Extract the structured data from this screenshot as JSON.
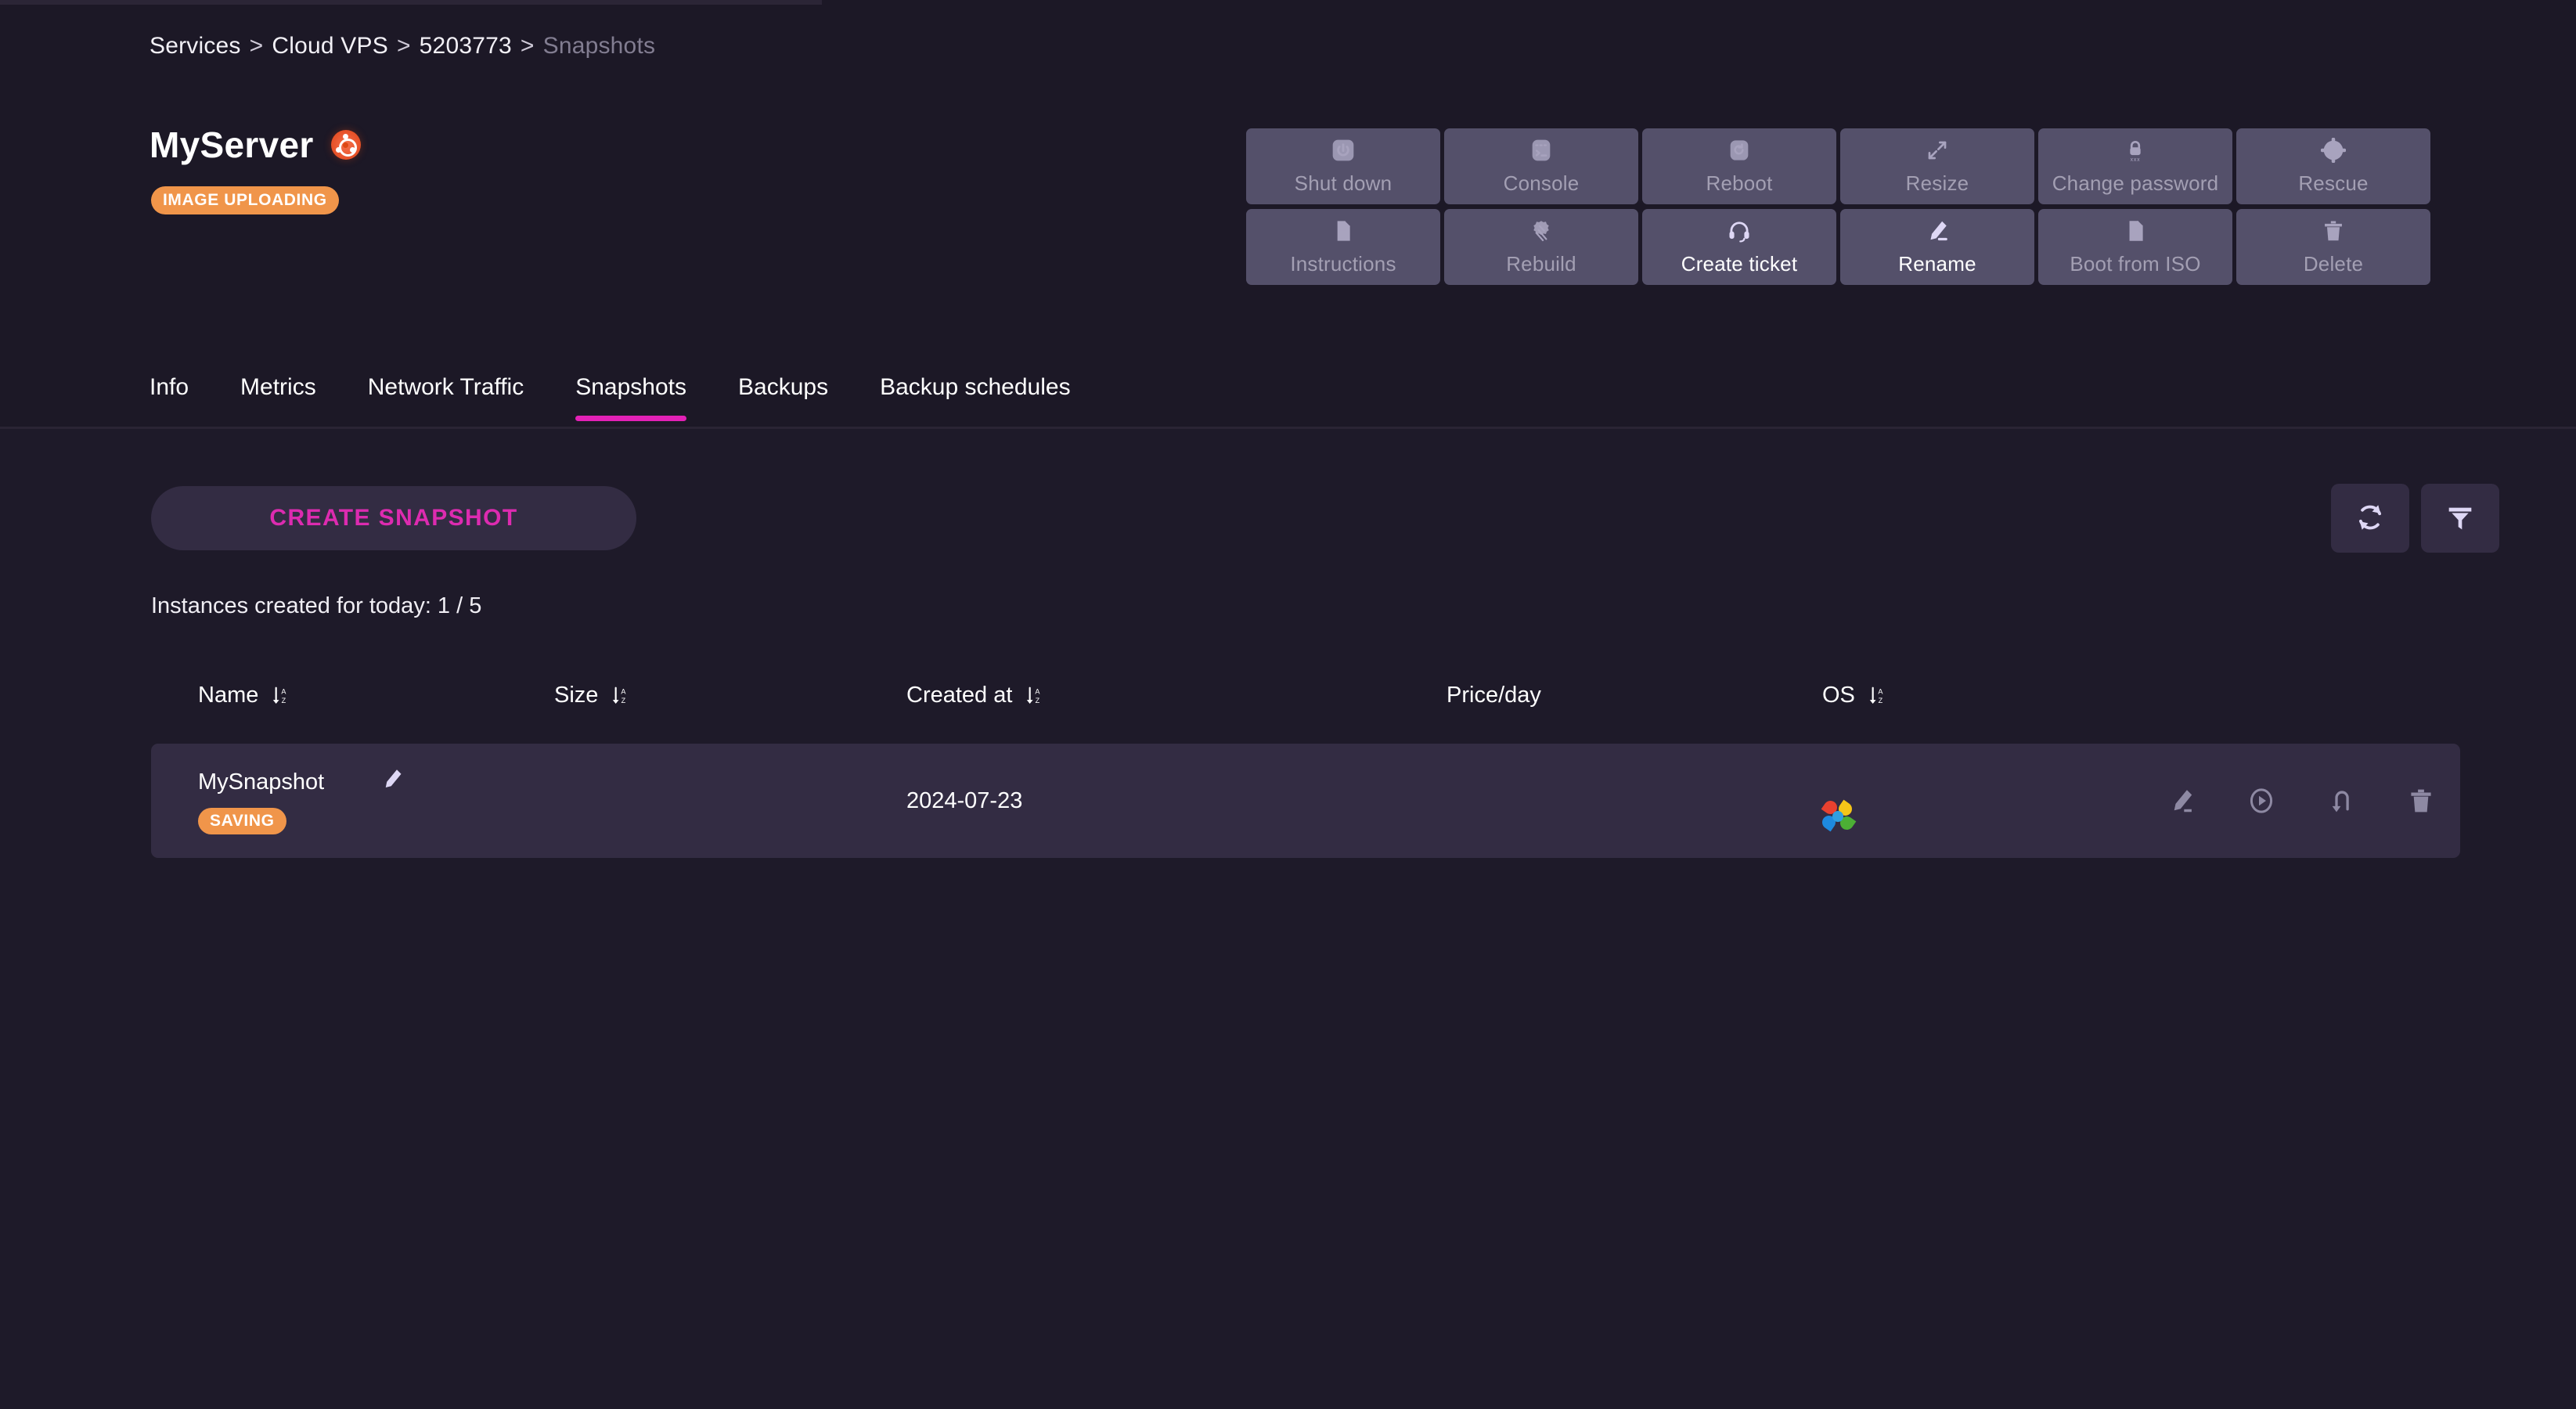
{
  "breadcrumb": {
    "items": [
      {
        "label": "Services",
        "muted": false
      },
      {
        "label": "Cloud VPS",
        "muted": false
      },
      {
        "label": "5203773",
        "muted": false
      },
      {
        "label": "Snapshots",
        "muted": true
      }
    ],
    "separator": ">"
  },
  "header": {
    "title": "MyServer",
    "os_icon": "ubuntu-logo-icon",
    "status_badge": "IMAGE UPLOADING",
    "status_color": "#f0954a"
  },
  "actions": [
    {
      "label": "Shut down",
      "icon": "power-icon",
      "enabled": false
    },
    {
      "label": "Console",
      "icon": "terminal-icon",
      "enabled": false
    },
    {
      "label": "Reboot",
      "icon": "restart-icon",
      "enabled": false
    },
    {
      "label": "Resize",
      "icon": "expand-icon",
      "enabled": false
    },
    {
      "label": "Change password",
      "icon": "lock-icon",
      "enabled": false
    },
    {
      "label": "Rescue",
      "icon": "lifebuoy-icon",
      "enabled": false
    },
    {
      "label": "Instructions",
      "icon": "document-icon",
      "enabled": false
    },
    {
      "label": "Rebuild",
      "icon": "rebuild-icon",
      "enabled": false
    },
    {
      "label": "Create ticket",
      "icon": "headset-icon",
      "enabled": true
    },
    {
      "label": "Rename",
      "icon": "pencil-icon",
      "enabled": true
    },
    {
      "label": "Boot from ISO",
      "icon": "iso-file-icon",
      "enabled": false
    },
    {
      "label": "Delete",
      "icon": "trash-icon",
      "enabled": false
    }
  ],
  "tabs": [
    {
      "label": "Info",
      "active": false
    },
    {
      "label": "Metrics",
      "active": false
    },
    {
      "label": "Network Traffic",
      "active": false
    },
    {
      "label": "Snapshots",
      "active": true
    },
    {
      "label": "Backups",
      "active": false
    },
    {
      "label": "Backup schedules",
      "active": false
    }
  ],
  "tab_accent_color": "#e321b6",
  "toolbar": {
    "create_snapshot_label": "CREATE SNAPSHOT",
    "instances_line": "Instances created for today: 1 / 5",
    "refresh_icon": "refresh-icon",
    "filter_icon": "filter-icon"
  },
  "table": {
    "columns": [
      {
        "label": "Name",
        "sortable": true
      },
      {
        "label": "Size",
        "sortable": true
      },
      {
        "label": "Created at",
        "sortable": true
      },
      {
        "label": "Price/day",
        "sortable": false
      },
      {
        "label": "OS",
        "sortable": true
      }
    ],
    "rows": [
      {
        "name": "MySnapshot",
        "status_badge": "SAVING",
        "status_color": "#f0954a",
        "size": "",
        "created_at": "2024-07-23",
        "price_per_day": "",
        "os_icon": "distro-logo-icon",
        "row_actions": [
          "pencil-icon",
          "play-circle-icon",
          "restore-arrow-icon",
          "trash-icon"
        ]
      }
    ]
  }
}
